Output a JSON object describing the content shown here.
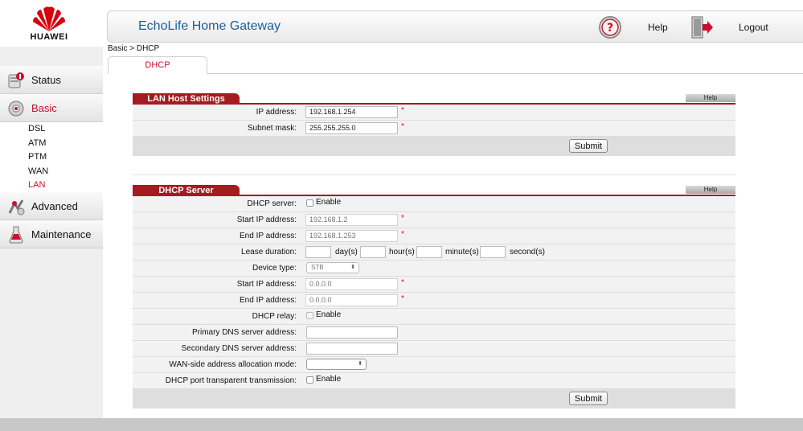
{
  "brand": {
    "logo_text": "HUAWEI"
  },
  "header": {
    "title": "EchoLife Home Gateway",
    "help_label": "Help",
    "logout_label": "Logout"
  },
  "sidebar": {
    "items": [
      {
        "label": "Status"
      },
      {
        "label": "Basic"
      },
      {
        "label": "Advanced"
      },
      {
        "label": "Maintenance"
      }
    ],
    "basic_sub": [
      "DSL",
      "ATM",
      "PTM",
      "WAN",
      "LAN"
    ]
  },
  "breadcrumb": "Basic > DHCP",
  "tab": {
    "label": "DHCP"
  },
  "lan_host": {
    "title": "LAN Host Settings",
    "help": "Help",
    "ip_label": "IP address:",
    "ip_value": "192.168.1.254",
    "mask_label": "Subnet mask:",
    "mask_value": "255.255.255.0",
    "required_mark": "*",
    "submit": "Submit"
  },
  "dhcp_server": {
    "title": "DHCP Server",
    "help": "Help",
    "required_mark": "*",
    "enable_text": "Enable",
    "server_label": "DHCP server:",
    "start_ip_label": "Start IP address:",
    "start_ip_value": "192.168.1.2",
    "end_ip_label": "End IP address:",
    "end_ip_value": "192.168.1.253",
    "lease_label": "Lease duration:",
    "lease_units": [
      "day(s)",
      "hour(s)",
      "minute(s)",
      "second(s)"
    ],
    "device_type_label": "Device type:",
    "device_type_value": "STB",
    "start_ip2_label": "Start IP address:",
    "start_ip2_value": "0.0.0.0",
    "end_ip2_label": "End IP address:",
    "end_ip2_value": "0.0.0.0",
    "relay_label": "DHCP relay:",
    "primary_dns_label": "Primary DNS server address:",
    "secondary_dns_label": "Secondary DNS server address:",
    "wan_alloc_label": "WAN-side address allocation mode:",
    "port_transparent_label": "DHCP port transparent transmission:",
    "submit": "Submit"
  },
  "colors": {
    "brand_red": "#c8102e",
    "section_red": "#a51b1f",
    "title_blue": "#1f5f94"
  }
}
